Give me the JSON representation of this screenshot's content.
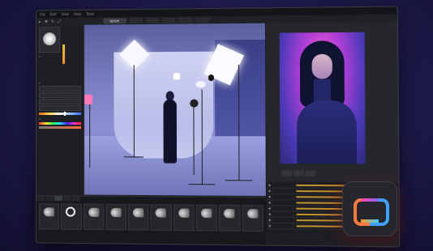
{
  "menubar": {
    "items": [
      "File",
      "Edit",
      "View",
      "Help",
      "Tools"
    ]
  },
  "toolbar": {
    "tabs": [
      "SETUP",
      "",
      "",
      "",
      "",
      ""
    ],
    "active_tab": 0
  },
  "left_panel": {
    "title": "",
    "properties": [
      {
        "label": "",
        "value": ""
      },
      {
        "label": "",
        "value": ""
      },
      {
        "label": "",
        "value": ""
      },
      {
        "label": "",
        "value": ""
      },
      {
        "label": "",
        "value": ""
      }
    ],
    "sections": [
      "",
      "",
      ""
    ],
    "fields": [
      "",
      "",
      "",
      ""
    ]
  },
  "right_panel": {
    "tabs": [
      "",
      "",
      ""
    ]
  },
  "layers": {
    "items": [
      "",
      "",
      "",
      "",
      "",
      "",
      "",
      ""
    ]
  },
  "bottom_panel": {
    "tabs": [
      "",
      "",
      "",
      "",
      ""
    ],
    "active_tab": 2,
    "thumbnails": [
      "",
      "",
      "",
      "",
      "",
      "",
      "",
      "",
      "",
      "",
      ""
    ]
  },
  "colors": {
    "accent": "#e2b532",
    "logo_orange": "#ff7a3c",
    "logo_blue": "#3fa1ff"
  },
  "icons": {
    "lamp": "light-preview-icon",
    "eye": "eye-icon",
    "logo": "app-logo-icon"
  }
}
